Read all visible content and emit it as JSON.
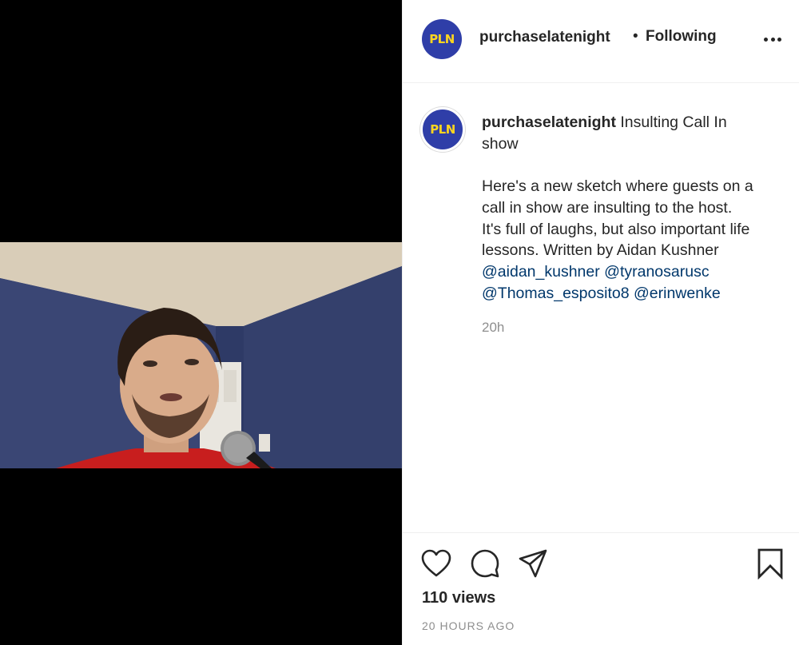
{
  "account": {
    "avatar_text": "PLN",
    "username": "purchaselatenight",
    "separator": "•",
    "follow_status": "Following"
  },
  "caption": {
    "username": "purchaselatenight",
    "title_lines": [
      "Insulting Call In",
      "show"
    ],
    "body_lines": [
      "Here's a new sketch where guests on a",
      "call in show are insulting to the host.",
      "It's full of laughs, but also important life",
      "lessons. Written by Aidan Kushner"
    ],
    "mentions_line1": [
      "@aidan_kushner",
      "@tyranosarusc"
    ],
    "mentions_line2": [
      "@Thomas_esposito8",
      "@erinwenke"
    ],
    "time_ago": "20h"
  },
  "stats": {
    "views": "110 views",
    "timestamp": "20 HOURS AGO"
  },
  "icons": [
    "more-options-icon",
    "heart-icon",
    "comment-icon",
    "share-icon",
    "bookmark-icon"
  ],
  "colors": {
    "avatar_bg": "#2f3ea8",
    "avatar_text": "#ffd51f",
    "mention": "#00376b",
    "muted": "#8e8e8e",
    "text": "#262626"
  }
}
